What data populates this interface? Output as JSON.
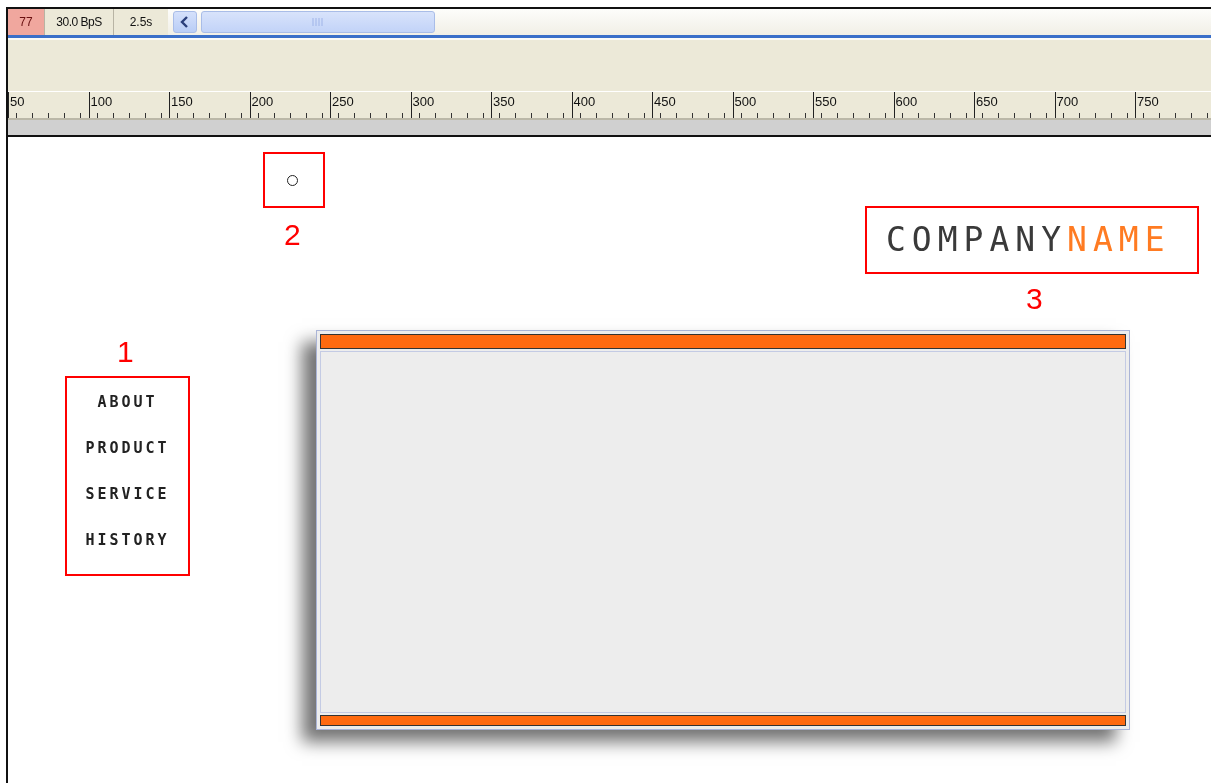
{
  "timeline": {
    "frame": "77",
    "frame_rate": "30.0 BpS",
    "elapsed": "2.5s"
  },
  "ruler": {
    "labels": [
      "50",
      "100",
      "150",
      "200",
      "250",
      "300",
      "350",
      "400",
      "450",
      "500",
      "550",
      "600",
      "650",
      "700",
      "750"
    ]
  },
  "stage": {
    "menu": {
      "items": [
        "ABOUT",
        "PRODUCT",
        "SERVICE",
        "HISTORY"
      ]
    },
    "logo": {
      "dark": "COMPANY",
      "accent": "NAME"
    },
    "callouts": [
      {
        "number": "1"
      },
      {
        "number": "2"
      },
      {
        "number": "3"
      }
    ]
  }
}
